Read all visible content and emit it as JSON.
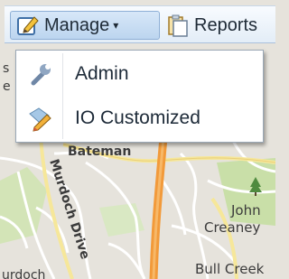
{
  "toolbar": {
    "manage_label": "Manage",
    "manage_caret": "▾",
    "reports_label": "Reports"
  },
  "menu": {
    "items": [
      {
        "label": "Admin",
        "icon": "wrench-icon"
      },
      {
        "label": "IO Customized",
        "icon": "pencil-tag-icon"
      }
    ]
  },
  "map": {
    "labels": {
      "bateman": "Bateman",
      "murdoch_drive": "Murdoch Drive",
      "john": "John",
      "creaney": "Creaney",
      "bull_creek": "Bull Creek",
      "murdoch_partial": "urdoch",
      "s_partial": "s",
      "e_partial": "e"
    }
  },
  "colors": {
    "map_bg": "#e6e3dc",
    "major_road": "#f29a3a",
    "road": "#ffffff",
    "road_yellow": "#f6e79a",
    "park": "#c9dfa8",
    "toolbar_highlight": "#bcd5ef"
  }
}
